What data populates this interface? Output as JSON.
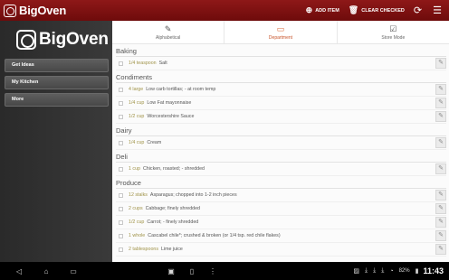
{
  "app": {
    "title": "BigOven"
  },
  "actionbar": {
    "add_item": "ADD ITEM",
    "clear_checked": "CLEAR CHECKED",
    "add_icon": "plus-circle-icon",
    "trash_icon": "trash-icon",
    "refresh_icon": "refresh-icon",
    "settings_icon": "sliders-icon"
  },
  "drawer": {
    "logo": "BigOven",
    "items": [
      {
        "label": "Get Ideas"
      },
      {
        "label": "My Kitchen"
      },
      {
        "label": "More"
      }
    ]
  },
  "tabs": [
    {
      "label": "Alphabetical",
      "icon": "pencil-icon",
      "active": false
    },
    {
      "label": "Department",
      "icon": "folder-icon",
      "active": true
    },
    {
      "label": "Store Mode",
      "icon": "checkbox-icon",
      "active": false
    }
  ],
  "list": {
    "sections": [
      {
        "title": "Baking",
        "items": [
          {
            "qty": "1/4 teaspoon",
            "name": "Salt"
          }
        ]
      },
      {
        "title": "Condiments",
        "items": [
          {
            "qty": "4 large",
            "name": "Low carb tortillas; - at room temp"
          },
          {
            "qty": "1/4 cup",
            "name": "Low Fat mayonnaise"
          },
          {
            "qty": "1/2 cup",
            "name": "Worcestershire Sauce"
          }
        ]
      },
      {
        "title": "Dairy",
        "items": [
          {
            "qty": "1/4 cup",
            "name": "Cream"
          }
        ]
      },
      {
        "title": "Deli",
        "items": [
          {
            "qty": "1 cup",
            "name": "Chicken, roasted; - shredded"
          }
        ]
      },
      {
        "title": "Produce",
        "items": [
          {
            "qty": "12 stalks",
            "name": "Asparagus; chopped into 1-2 inch pieces"
          },
          {
            "qty": "2 cups",
            "name": "Cabbage; finely shredded"
          },
          {
            "qty": "1/2 cup",
            "name": "Carrot; - finely shredded"
          },
          {
            "qty": "1 whole",
            "name": "Cascabel chile*; crushed & broken (or 1/4 tsp. red chile flakes)"
          },
          {
            "qty": "2 tablespoons",
            "name": "Lime juice"
          }
        ]
      }
    ]
  },
  "statusbar": {
    "time": "11:43",
    "battery": "82%"
  }
}
